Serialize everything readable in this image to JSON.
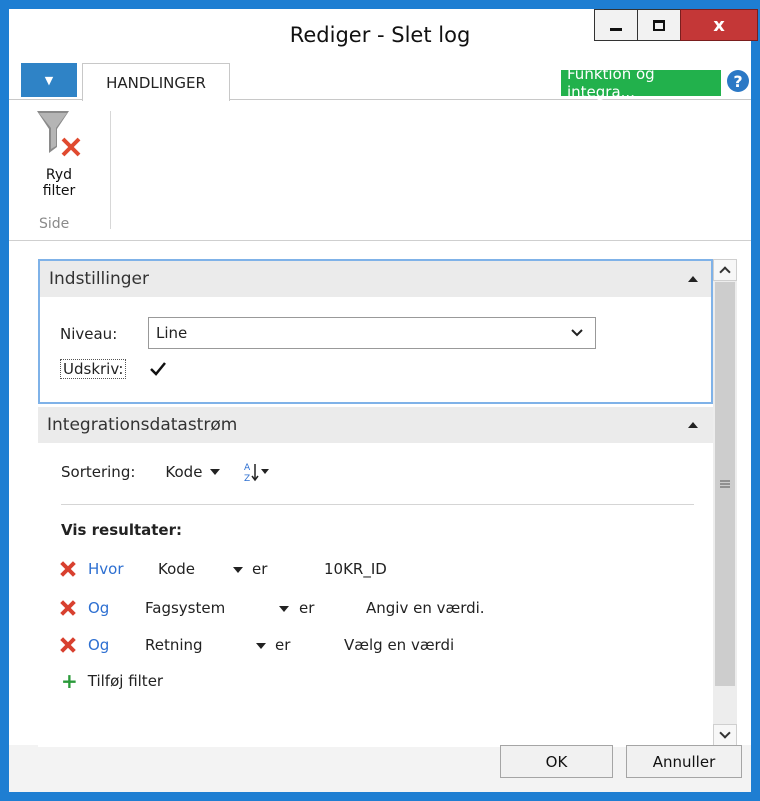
{
  "window": {
    "title": "Rediger - Slet log",
    "close_label": "x"
  },
  "ribbon": {
    "tab_label": "HANDLINGER",
    "badge_label": "Funktion og integra...",
    "help_label": "?",
    "clear_filter_label_1": "Ryd",
    "clear_filter_label_2": "filter",
    "group_label": "Side"
  },
  "settings": {
    "header": "Indstillinger",
    "niveau_label": "Niveau:",
    "niveau_value": "Line",
    "udskriv_label": "Udskriv:",
    "udskriv_checked": true
  },
  "integration": {
    "header": "Integrationsdatastrøm",
    "sort_label": "Sortering:",
    "sort_value": "Kode",
    "results_label": "Vis resultater:",
    "filters": [
      {
        "conj": "Hvor",
        "field": "Kode",
        "op": "er",
        "value": "10KR_ID"
      },
      {
        "conj": "Og",
        "field": "Fagsystem",
        "op": "er",
        "value": "Angiv en værdi."
      },
      {
        "conj": "Og",
        "field": "Retning",
        "op": "er",
        "value": "Vælg en værdi"
      }
    ],
    "add_filter_label": "Tilføj filter"
  },
  "footer": {
    "ok_label": "OK",
    "cancel_label": "Annuller"
  },
  "colors": {
    "frame": "#1e7ed2",
    "badge": "#22b14c",
    "link": "#2d6fd1",
    "remove": "#d8402f",
    "add": "#2a9a3a"
  }
}
